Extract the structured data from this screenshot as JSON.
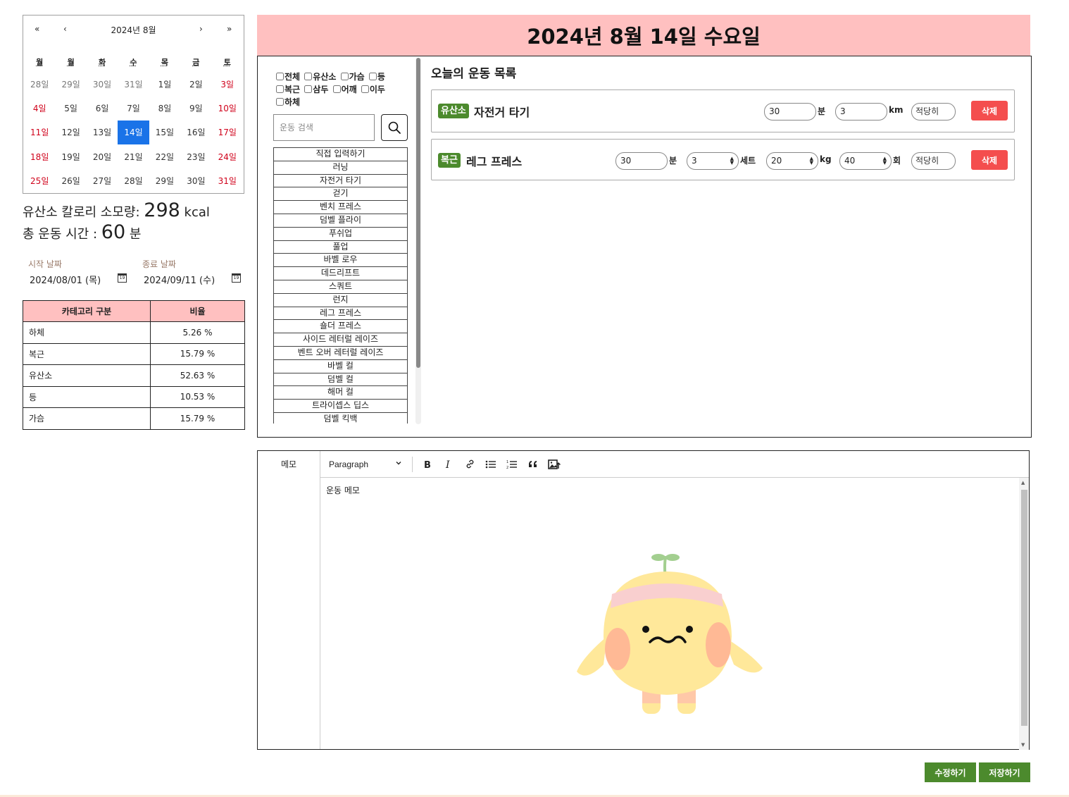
{
  "calendar": {
    "nav": {
      "prev_year": "«",
      "prev_month": "‹",
      "title": "2024년 8월",
      "next_month": "›",
      "next_year": "»"
    },
    "weekdays": [
      "월",
      "월",
      "화",
      "수",
      "목",
      "금",
      "토"
    ],
    "days": [
      {
        "label": "28일",
        "dim": true,
        "weekend": false
      },
      {
        "label": "29일",
        "dim": true,
        "weekend": false
      },
      {
        "label": "30일",
        "dim": true,
        "weekend": false
      },
      {
        "label": "31일",
        "dim": true,
        "weekend": false
      },
      {
        "label": "1일",
        "dim": false,
        "weekend": false
      },
      {
        "label": "2일",
        "dim": false,
        "weekend": false
      },
      {
        "label": "3일",
        "dim": false,
        "weekend": true
      },
      {
        "label": "4일",
        "dim": false,
        "weekend": true
      },
      {
        "label": "5일",
        "dim": false,
        "weekend": false
      },
      {
        "label": "6일",
        "dim": false,
        "weekend": false
      },
      {
        "label": "7일",
        "dim": false,
        "weekend": false
      },
      {
        "label": "8일",
        "dim": false,
        "weekend": false
      },
      {
        "label": "9일",
        "dim": false,
        "weekend": false
      },
      {
        "label": "10일",
        "dim": false,
        "weekend": true
      },
      {
        "label": "11일",
        "dim": false,
        "weekend": true
      },
      {
        "label": "12일",
        "dim": false,
        "weekend": false
      },
      {
        "label": "13일",
        "dim": false,
        "weekend": false
      },
      {
        "label": "14일",
        "dim": false,
        "weekend": false,
        "selected": true
      },
      {
        "label": "15일",
        "dim": false,
        "weekend": false
      },
      {
        "label": "16일",
        "dim": false,
        "weekend": false
      },
      {
        "label": "17일",
        "dim": false,
        "weekend": true
      },
      {
        "label": "18일",
        "dim": false,
        "weekend": true
      },
      {
        "label": "19일",
        "dim": false,
        "weekend": false
      },
      {
        "label": "20일",
        "dim": false,
        "weekend": false
      },
      {
        "label": "21일",
        "dim": false,
        "weekend": false
      },
      {
        "label": "22일",
        "dim": false,
        "weekend": false
      },
      {
        "label": "23일",
        "dim": false,
        "weekend": false
      },
      {
        "label": "24일",
        "dim": false,
        "weekend": true
      },
      {
        "label": "25일",
        "dim": false,
        "weekend": true
      },
      {
        "label": "26일",
        "dim": false,
        "weekend": false
      },
      {
        "label": "27일",
        "dim": false,
        "weekend": false
      },
      {
        "label": "28일",
        "dim": false,
        "weekend": false
      },
      {
        "label": "29일",
        "dim": false,
        "weekend": false
      },
      {
        "label": "30일",
        "dim": false,
        "weekend": false
      },
      {
        "label": "31일",
        "dim": false,
        "weekend": true
      }
    ]
  },
  "stats": {
    "calorie_label": "유산소 칼로리 소모량: ",
    "calorie_value": "298",
    "calorie_unit": " kcal",
    "time_label": "총 운동 시간 : ",
    "time_value": "60",
    "time_unit": " 분"
  },
  "date_range": {
    "start_label": "시작 날짜",
    "start_value": "2024/08/01 (목)",
    "end_label": "종료 날짜",
    "end_value": "2024/09/11 (수)",
    "calendar_icon_text": "19"
  },
  "category_table": {
    "headers": [
      "카테고리 구분",
      "비율"
    ],
    "rows": [
      [
        "하체",
        "5.26 %"
      ],
      [
        "복근",
        "15.79 %"
      ],
      [
        "유산소",
        "52.63 %"
      ],
      [
        "등",
        "10.53 %"
      ],
      [
        "가슴",
        "15.79 %"
      ]
    ]
  },
  "header": {
    "date_title": "2024년 8월 14일 수요일"
  },
  "filters": [
    "전체",
    "유산소",
    "가슴",
    "등",
    "복근",
    "삼두",
    "어깨",
    "이두",
    "하체"
  ],
  "search": {
    "placeholder": "운동 검색"
  },
  "exercise_list": [
    "직접 입력하기",
    "러닝",
    "자전거 타기",
    "걷기",
    "벤치 프레스",
    "덤벨 플라이",
    "푸쉬업",
    "풀업",
    "바벨 로우",
    "데드리프트",
    "스쿼트",
    "런지",
    "레그 프레스",
    "숄더 프레스",
    "사이드 레터럴 레이즈",
    "벤트 오버 레터럴 레이즈",
    "바벨 컬",
    "덤벨 컬",
    "해머 컬",
    "트라이셉스 딥스",
    "덤벨 킥백"
  ],
  "today": {
    "title": "오늘의 운동 목록",
    "workouts": [
      {
        "tag": "유산소",
        "name": "자전거 타기",
        "minutes": "30",
        "minutes_unit": "분",
        "distance": "3",
        "distance_unit": "km",
        "intensity": "적당히",
        "delete_label": "삭제"
      },
      {
        "tag": "복근",
        "name": "레그 프레스",
        "minutes": "30",
        "minutes_unit": "분",
        "sets": "3",
        "sets_unit": "세트",
        "weight": "20",
        "weight_unit": "kg",
        "reps": "40",
        "reps_unit": "회",
        "intensity": "적당히",
        "delete_label": "삭제"
      }
    ]
  },
  "memo": {
    "label": "메모",
    "format_select": "Paragraph",
    "content": "운동 메모"
  },
  "actions": {
    "edit_label": "수정하기",
    "save_label": "저장하기"
  },
  "colors": {
    "header_pink": "#ffc0c0",
    "accent_green": "#4c8a2d",
    "delete_red": "#f44e4e",
    "selected_blue": "#1a73e8"
  }
}
